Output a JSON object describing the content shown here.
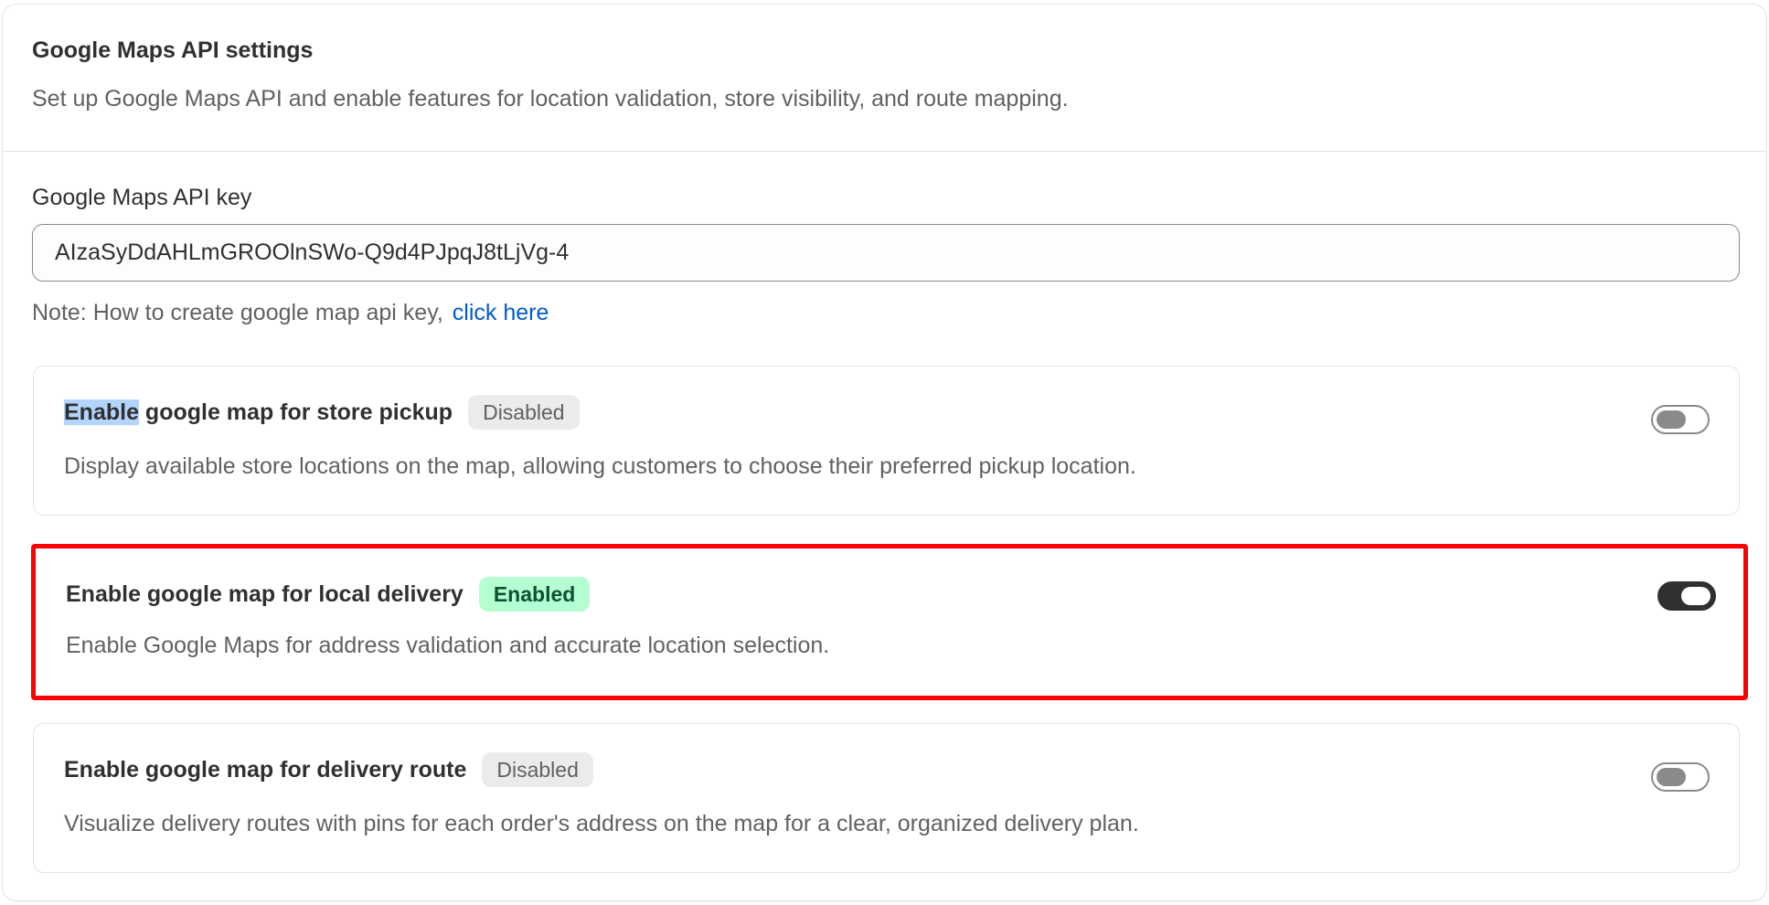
{
  "header": {
    "title": "Google Maps API settings",
    "subtitle": "Set up Google Maps API and enable features for location validation, store visibility, and route mapping."
  },
  "api_key": {
    "label": "Google Maps API key",
    "value": "AIzaSyDdAHLmGROOlnSWo-Q9d4PJpqJ8tLjVg-4"
  },
  "note": {
    "text": "Note: How to create google map api key,",
    "link": "click here"
  },
  "features": [
    {
      "title_selected": "Enable",
      "title_rest": " google map for store pickup",
      "badge": "Disabled",
      "enabled": false,
      "description": "Display available store locations on the map, allowing customers to choose their preferred pickup location."
    },
    {
      "title": "Enable google map for local delivery",
      "badge": "Enabled",
      "enabled": true,
      "description": "Enable Google Maps for address validation and accurate location selection."
    },
    {
      "title": "Enable google map for delivery route",
      "badge": "Disabled",
      "enabled": false,
      "description": "Visualize delivery routes with pins for each order's address on the map for a clear, organized delivery plan."
    }
  ],
  "colors": {
    "link": "#005bd3",
    "highlight_border": "#ff0000",
    "badge_enabled_bg": "#b4fed2",
    "badge_disabled_bg": "#ebebeb",
    "toggle_on": "#303030"
  }
}
